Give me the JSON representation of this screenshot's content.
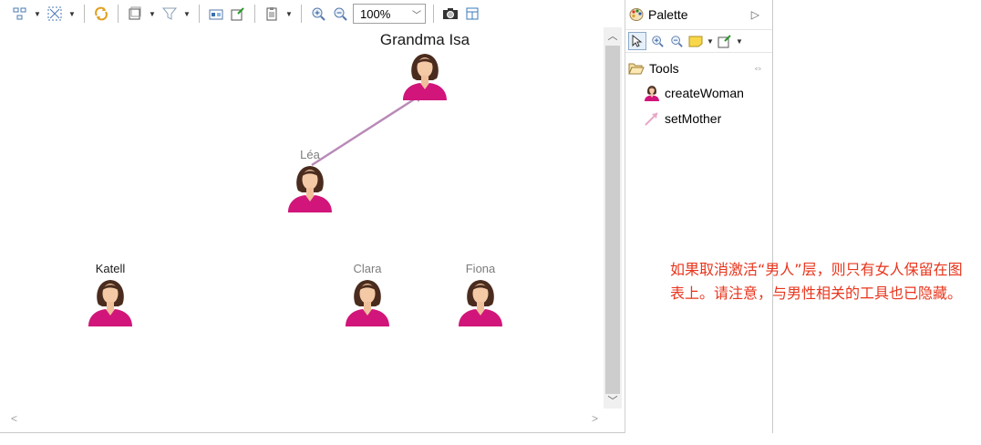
{
  "toolbar": {
    "zoom_value": "100%"
  },
  "diagram": {
    "nodes": [
      {
        "id": "grandma",
        "label": "Grandma Isa"
      },
      {
        "id": "lea",
        "label": "Léa"
      },
      {
        "id": "katell",
        "label": "Katell"
      },
      {
        "id": "clara",
        "label": "Clara"
      },
      {
        "id": "fiona",
        "label": "Fiona"
      }
    ],
    "edges": [
      {
        "from": "Léa",
        "to": "Grandma Isa",
        "type": "setMother",
        "color": "#b88ab8"
      }
    ]
  },
  "palette": {
    "title": "Palette",
    "drawer_title": "Tools",
    "items": [
      {
        "label": "createWoman",
        "icon": "woman-icon"
      },
      {
        "label": "setMother",
        "icon": "mother-link-icon"
      }
    ]
  },
  "annotation": {
    "text": "如果取消激活“男人”层，则只有女人保留在图表上。请注意，与男性相关的工具也已隐藏。"
  },
  "colors": {
    "annotation": "#e8351c",
    "woman_shirt": "#d1157a",
    "edge": "#b88ab8"
  }
}
